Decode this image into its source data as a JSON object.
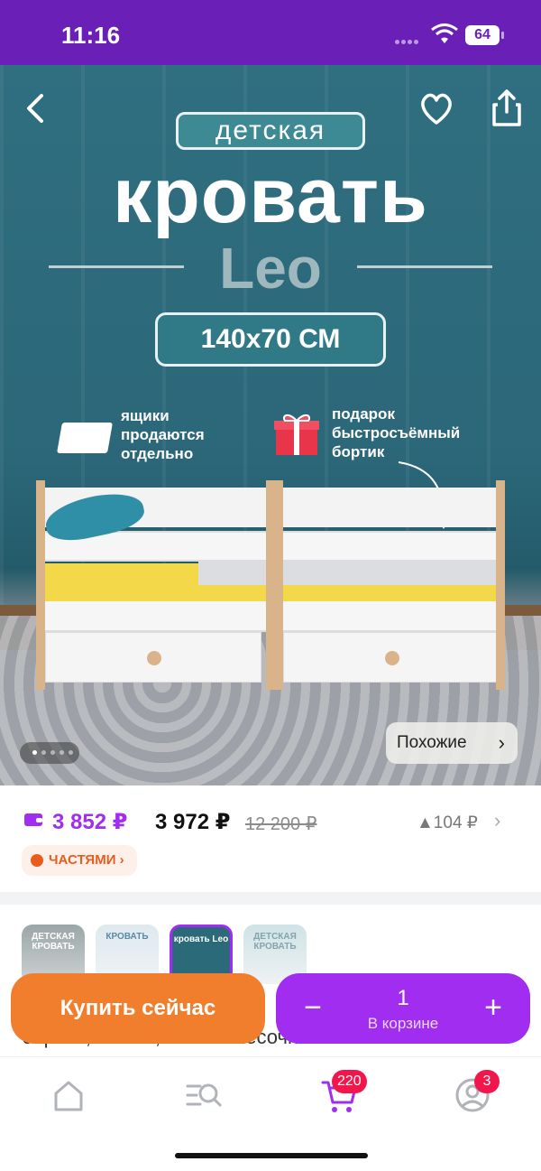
{
  "status_bar": {
    "time": "11:16",
    "battery": "64"
  },
  "hero": {
    "promo_pill": "детская",
    "promo_title": "кровать",
    "promo_brand": "Leo",
    "promo_size": "140x70 СМ",
    "note_drawers": "ящики продаются отдельно",
    "note_gift": "подарок быстросъёмный бортик",
    "similar_label": "Похожие",
    "slide_count": 5,
    "active_slide": 0
  },
  "price": {
    "card_price": "3 852 ₽",
    "main_price": "3 972 ₽",
    "old_price": "12 200 ₽",
    "delta": "▲104 ₽",
    "parts_label": "ЧАСТЯМИ ›"
  },
  "thumbnails": [
    {
      "label": "ДЕТСКАЯ КРОВАТЬ"
    },
    {
      "label": "КРОВАТЬ"
    },
    {
      "label": "кровать Leo"
    },
    {
      "label": "ДЕТСКАЯ КРОВАТЬ"
    }
  ],
  "description_partial": "береза, белый, светло-песочный - 70x140 см",
  "actions": {
    "buy_now": "Купить сейчас",
    "quantity": "1",
    "in_cart_label": "В корзине",
    "minus": "−",
    "plus": "+"
  },
  "bottom_nav": {
    "cart_badge": "220",
    "profile_badge": "3"
  },
  "colors": {
    "status_bar": "#6a1fb6",
    "accent_purple": "#a12df0",
    "buy_orange": "#f07e2c",
    "badge_red": "#f1174d"
  }
}
